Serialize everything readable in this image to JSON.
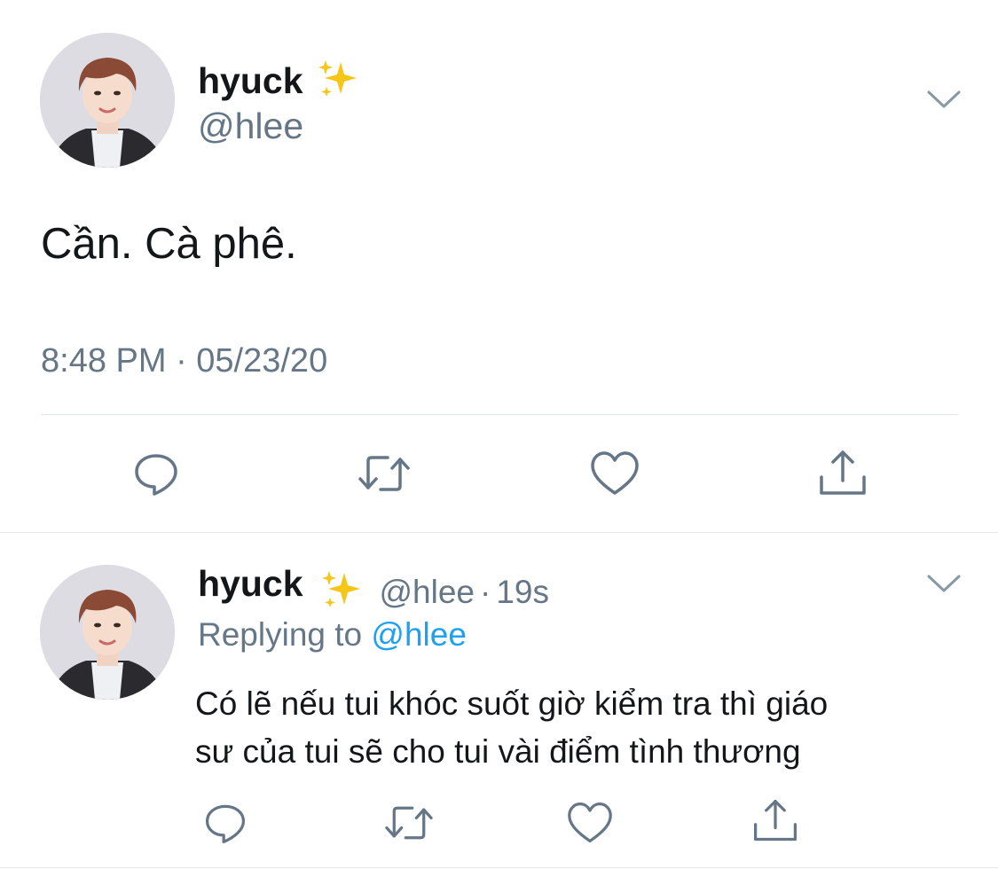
{
  "main_tweet": {
    "display_name": "hyuck",
    "emoji": "✨",
    "handle": "@hlee",
    "text": "Cần. Cà phê.",
    "timestamp": "8:48 PM · 05/23/20",
    "actions": [
      "reply-icon",
      "retweet-icon",
      "like-icon",
      "share-icon"
    ]
  },
  "reply_tweet": {
    "display_name": "hyuck",
    "emoji": "✨",
    "handle": "@hlee",
    "separator": "·",
    "time_ago": "19s",
    "replying_label": "Replying to",
    "replying_handle": "@hlee",
    "text_line1": "Có lẽ nếu tui khóc suốt giờ kiểm tra thì giáo",
    "text_line2": "sư của tui sẽ cho tui vài điểm tình thương",
    "actions": [
      "reply-icon",
      "retweet-icon",
      "like-icon",
      "share-icon"
    ]
  },
  "colors": {
    "text": "#14171a",
    "secondary": "#657786",
    "link": "#1da1f2",
    "divider": "#e1e8ed",
    "icon": "#657786"
  }
}
